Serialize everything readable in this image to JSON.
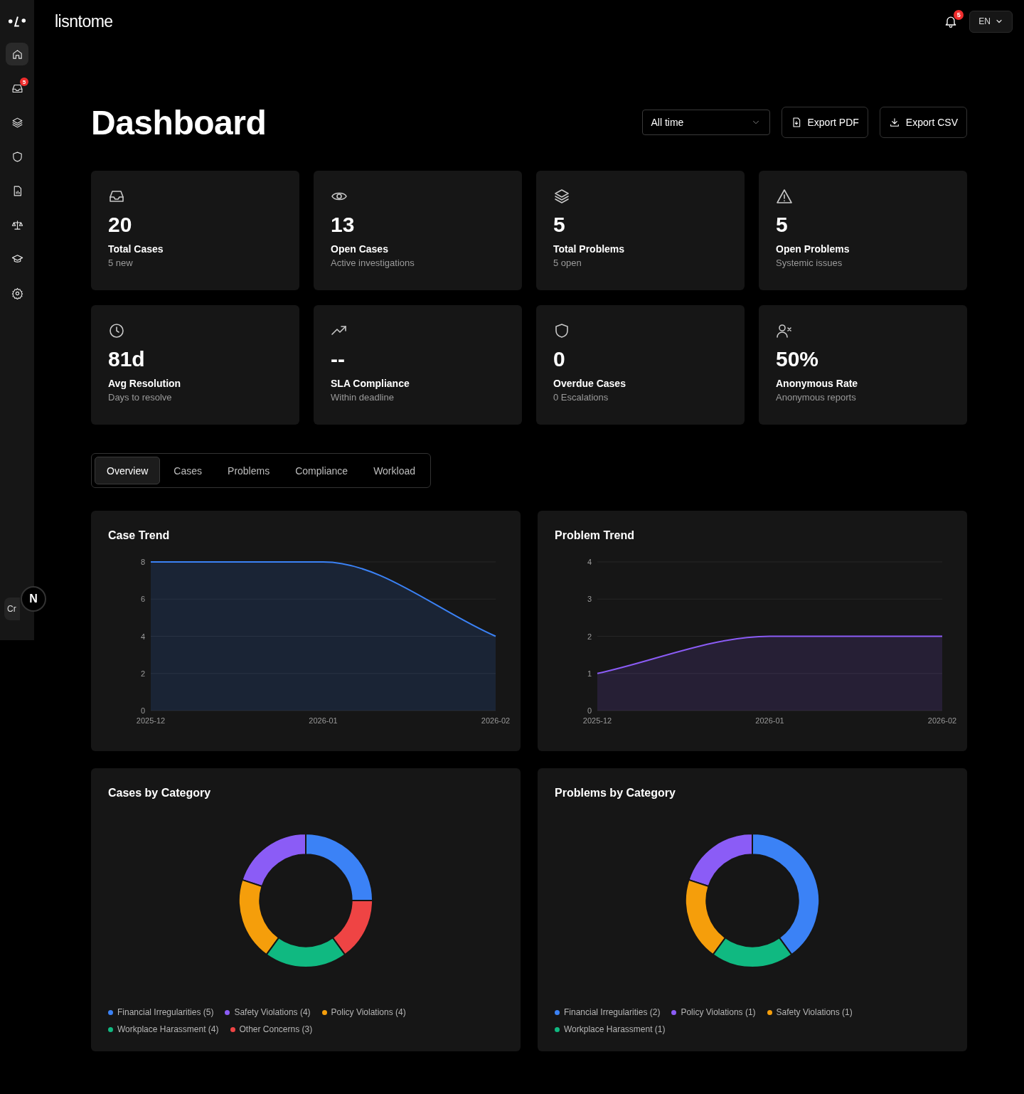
{
  "sidebar": {
    "items": [
      {
        "selected": true
      },
      {
        "selected": false,
        "badge": "5"
      },
      {
        "selected": false
      },
      {
        "selected": false
      },
      {
        "selected": false
      },
      {
        "selected": false
      },
      {
        "selected": false
      },
      {
        "selected": false
      }
    ],
    "footer_button": "Cr",
    "dev_badge": "N"
  },
  "header": {
    "brand": "lisntome",
    "notifications": "5",
    "language": "EN"
  },
  "page": {
    "title": "Dashboard",
    "period": "All time",
    "buttons": [
      "Export PDF",
      "Export CSV"
    ]
  },
  "stats": [
    {
      "value": "20",
      "label": "Total Cases",
      "sub": "5 new"
    },
    {
      "value": "13",
      "label": "Open Cases",
      "sub": "Active investigations"
    },
    {
      "value": "5",
      "label": "Total Problems",
      "sub": "5 open"
    },
    {
      "value": "5",
      "label": "Open Problems",
      "sub": "Systemic issues"
    },
    {
      "value": "81d",
      "label": "Avg Resolution",
      "sub": "Days to resolve"
    },
    {
      "value": "--",
      "label": "SLA Compliance",
      "sub": "Within deadline"
    },
    {
      "value": "0",
      "label": "Overdue Cases",
      "sub": "0 Escalations"
    },
    {
      "value": "50%",
      "label": "Anonymous Rate",
      "sub": "Anonymous reports"
    }
  ],
  "tabs": [
    {
      "label": "Overview",
      "selected": true
    },
    {
      "label": "Cases",
      "selected": false
    },
    {
      "label": "Problems",
      "selected": false
    },
    {
      "label": "Compliance",
      "selected": false
    },
    {
      "label": "Workload",
      "selected": false
    }
  ],
  "trend_charts": [
    {
      "title": "Case Trend",
      "chart_data": {
        "type": "area",
        "categories": [
          "2025-12",
          "2026-01",
          "2026-02"
        ],
        "series": [
          {
            "color": "#3b82f6",
            "values": [
              8,
              8,
              4
            ]
          }
        ],
        "ylim": [
          0,
          8
        ],
        "yticks": [
          0,
          2,
          4,
          6,
          8
        ],
        "grid": true
      }
    },
    {
      "title": "Problem Trend",
      "chart_data": {
        "type": "area",
        "categories": [
          "2025-12",
          "2026-01",
          "2026-02"
        ],
        "series": [
          {
            "color": "#8b5cf6",
            "values": [
              1,
              2,
              2
            ]
          }
        ],
        "ylim": [
          0,
          4
        ],
        "yticks": [
          0,
          1,
          2,
          3,
          4
        ],
        "grid": true
      }
    }
  ],
  "category_charts": [
    {
      "title": "Cases by Category",
      "chart_data": {
        "type": "donut",
        "categories": [
          "Financial Irregularities (5)",
          "Safety Violations (4)",
          "Policy Violations (4)",
          "Workplace Harassment (4)",
          "Other Concerns (3)"
        ],
        "values": [
          5,
          4,
          4,
          4,
          3
        ],
        "colors": [
          "#3b82f6",
          "#8b5cf6",
          "#f59e0b",
          "#10b981",
          "#ef4444"
        ]
      }
    },
    {
      "title": "Problems by Category",
      "chart_data": {
        "type": "donut",
        "categories": [
          "Financial Irregularities (2)",
          "Policy Violations (1)",
          "Safety Violations (1)",
          "Workplace Harassment (1)"
        ],
        "values": [
          2,
          1,
          1,
          1
        ],
        "colors": [
          "#3b82f6",
          "#8b5cf6",
          "#f59e0b",
          "#10b981"
        ]
      }
    }
  ]
}
